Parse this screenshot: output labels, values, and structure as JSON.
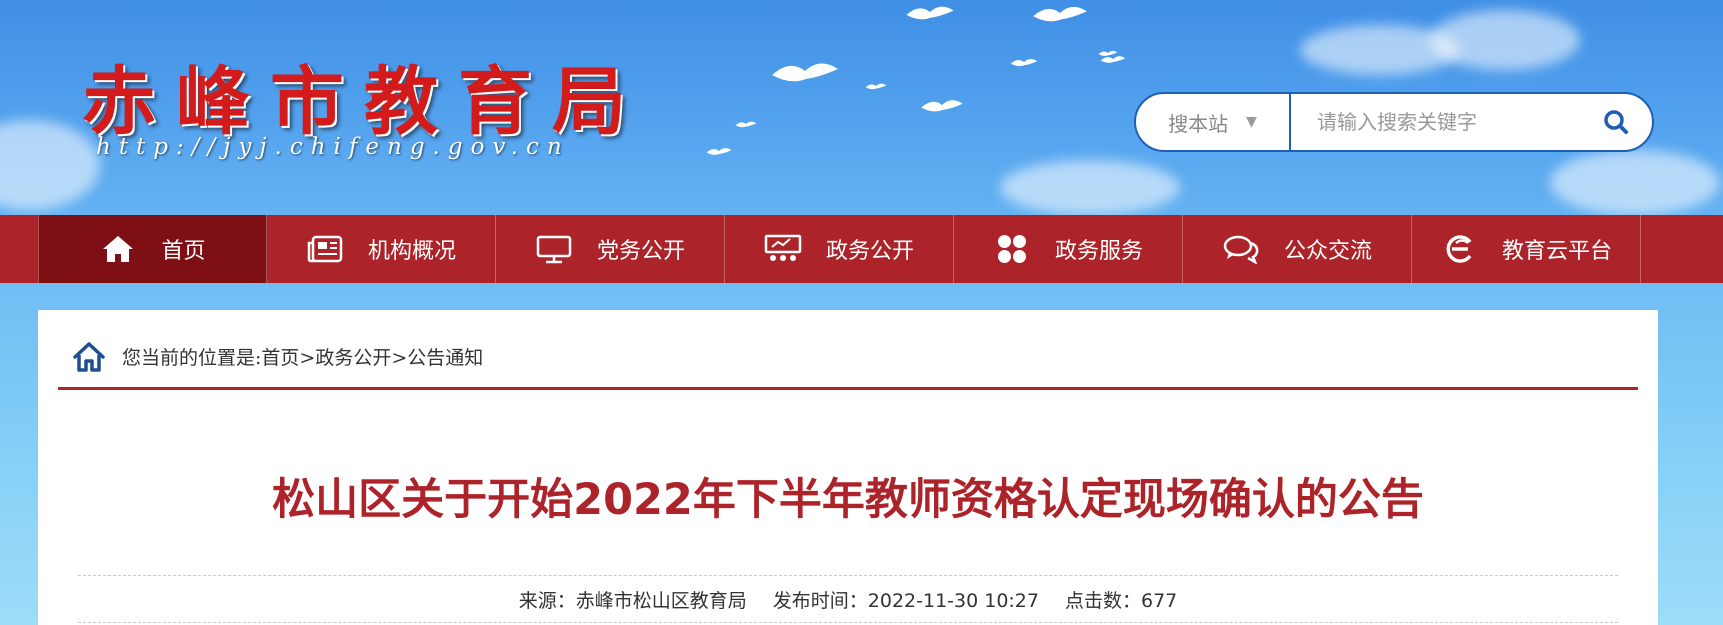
{
  "site": {
    "title": "赤峰市教育局",
    "url": "http://jyj.chifeng.gov.cn"
  },
  "search": {
    "scope": "搜本站",
    "placeholder": "请输入搜索关键字",
    "scope_arrow_icon": "caret-down-icon",
    "button_icon": "search-icon"
  },
  "nav": {
    "items": [
      {
        "label": "首页",
        "icon": "home-icon"
      },
      {
        "label": "机构概况",
        "icon": "newspaper-icon"
      },
      {
        "label": "党务公开",
        "icon": "monitor-icon"
      },
      {
        "label": "政务公开",
        "icon": "board-icon"
      },
      {
        "label": "政务服务",
        "icon": "clover-icon"
      },
      {
        "label": "公众交流",
        "icon": "chat-icon"
      },
      {
        "label": "教育云平台",
        "icon": "cloud-e-icon"
      }
    ]
  },
  "breadcrumb": {
    "text": "您当前的位置是:首页>政务公开>公告通知"
  },
  "article": {
    "title": "松山区关于开始2022年下半年教师资格认定现场确认的公告",
    "source": "来源：赤峰市松山区教育局",
    "publish_time": "发布时间：2022-11-30 10:27",
    "clicks": "点击数：677"
  },
  "colors": {
    "brand_red": "#ac2429",
    "nav_active": "#7e0f14",
    "title_red": "#d31b1b",
    "search_border": "#1e5fb3"
  }
}
